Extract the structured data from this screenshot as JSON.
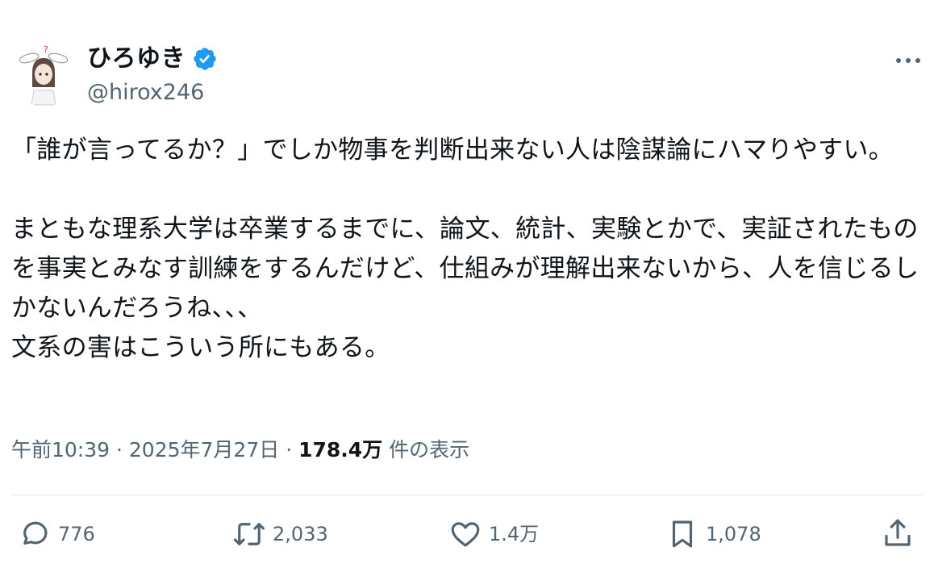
{
  "author": {
    "display_name": "ひろゆき",
    "handle": "@hirox246",
    "avatar_icon": "avatar-illustration",
    "verified_icon": "verified-badge-icon",
    "verified_color": "#1d9bf0"
  },
  "more_icon": "more-options-icon",
  "tweet": {
    "text": "「誰が言ってるか？」でしか物事を判断出来ない人は陰謀論にハマりやすい。\n\nまともな理系大学は卒業するまでに、論文、統計、実験とかで、実証されたものを事実とみなす訓練をするんだけど、仕組みが理解出来ないから、人を信じるしかないんだろうね、、、\n文系の害はこういう所にもある。"
  },
  "meta": {
    "time": "午前10:39",
    "separator": "·",
    "date": "2025年7月27日",
    "views": "178.4万",
    "views_label": "件の表示"
  },
  "actions": {
    "replies": {
      "icon": "reply-icon",
      "count": "776"
    },
    "retweets": {
      "icon": "retweet-icon",
      "count": "2,033"
    },
    "likes": {
      "icon": "heart-icon",
      "count": "1.4万"
    },
    "bookmarks": {
      "icon": "bookmark-icon",
      "count": "1,078"
    },
    "share": {
      "icon": "share-icon"
    }
  },
  "colors": {
    "text": "#0f1419",
    "secondary": "#536471",
    "divider": "#e1e8ed"
  }
}
